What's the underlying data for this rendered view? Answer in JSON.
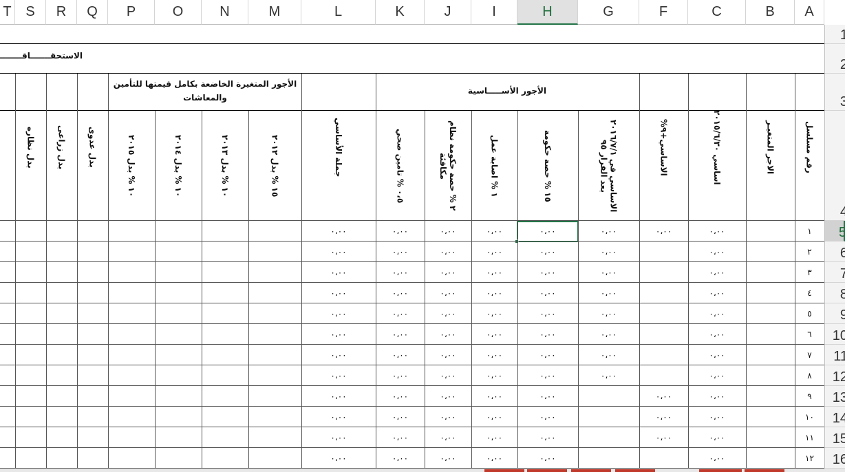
{
  "columns": [
    {
      "id": "T",
      "label": "T"
    },
    {
      "id": "S",
      "label": "S"
    },
    {
      "id": "R",
      "label": "R"
    },
    {
      "id": "Q",
      "label": "Q"
    },
    {
      "id": "P",
      "label": "P"
    },
    {
      "id": "O",
      "label": "O"
    },
    {
      "id": "N",
      "label": "N"
    },
    {
      "id": "M",
      "label": "M"
    },
    {
      "id": "L",
      "label": "L"
    },
    {
      "id": "K",
      "label": "K"
    },
    {
      "id": "J",
      "label": "J"
    },
    {
      "id": "I",
      "label": "I"
    },
    {
      "id": "H",
      "label": "H"
    },
    {
      "id": "G",
      "label": "G"
    },
    {
      "id": "F",
      "label": "F"
    },
    {
      "id": "C",
      "label": "C"
    },
    {
      "id": "B",
      "label": "B"
    },
    {
      "id": "A",
      "label": "A"
    }
  ],
  "active_column": "H",
  "rows": [
    "1",
    "2",
    "3",
    "4",
    "5",
    "6",
    "7",
    "8",
    "9",
    "10",
    "11",
    "12",
    "13",
    "14",
    "15",
    "16"
  ],
  "active_row": "5",
  "title_row2": "الاستحقـــــــاقـــــــــــــ",
  "group_basic_wages": "الأجور الأســـــاسية",
  "group_variable_wages": "الأجور المتغيرة الخاضعة بكامل قيمتها للتأمين والمعاشات",
  "headers": {
    "A": "رقم مسلسل",
    "B": "الاجر المتغيـر",
    "C": "اساسي ٢٠١٥/٦/٣٠",
    "F": "الاساسي+٩%",
    "G": "الاساسي في ٢٠١٦/٧/١ بعد القرار ٩٥",
    "H": "١٥ % حصة حكومة",
    "I": "١ % اصابة عمل",
    "J": "٢ % حصة حكومة نظام مكافئة",
    "K": "٠،٥ % تامين صحي",
    "L": "جملة الأساسي",
    "M": "١٥ % بدل ٢٠١٢",
    "N": "١٠ % بدل ٢٠١٣",
    "O": "١٠ % بدل ٢٠١٤",
    "P": "١٠ % بدل ٢٠١٥",
    "Q": "بدل عدوى",
    "R": "بدل زراعى",
    "S": "بدل نظاره"
  },
  "zero_value": "٠،٠٠",
  "serials": [
    "١",
    "٢",
    "٣",
    "٤",
    "٥",
    "٦",
    "٧",
    "٨",
    "٩",
    "١٠",
    "١١",
    "١٢"
  ]
}
